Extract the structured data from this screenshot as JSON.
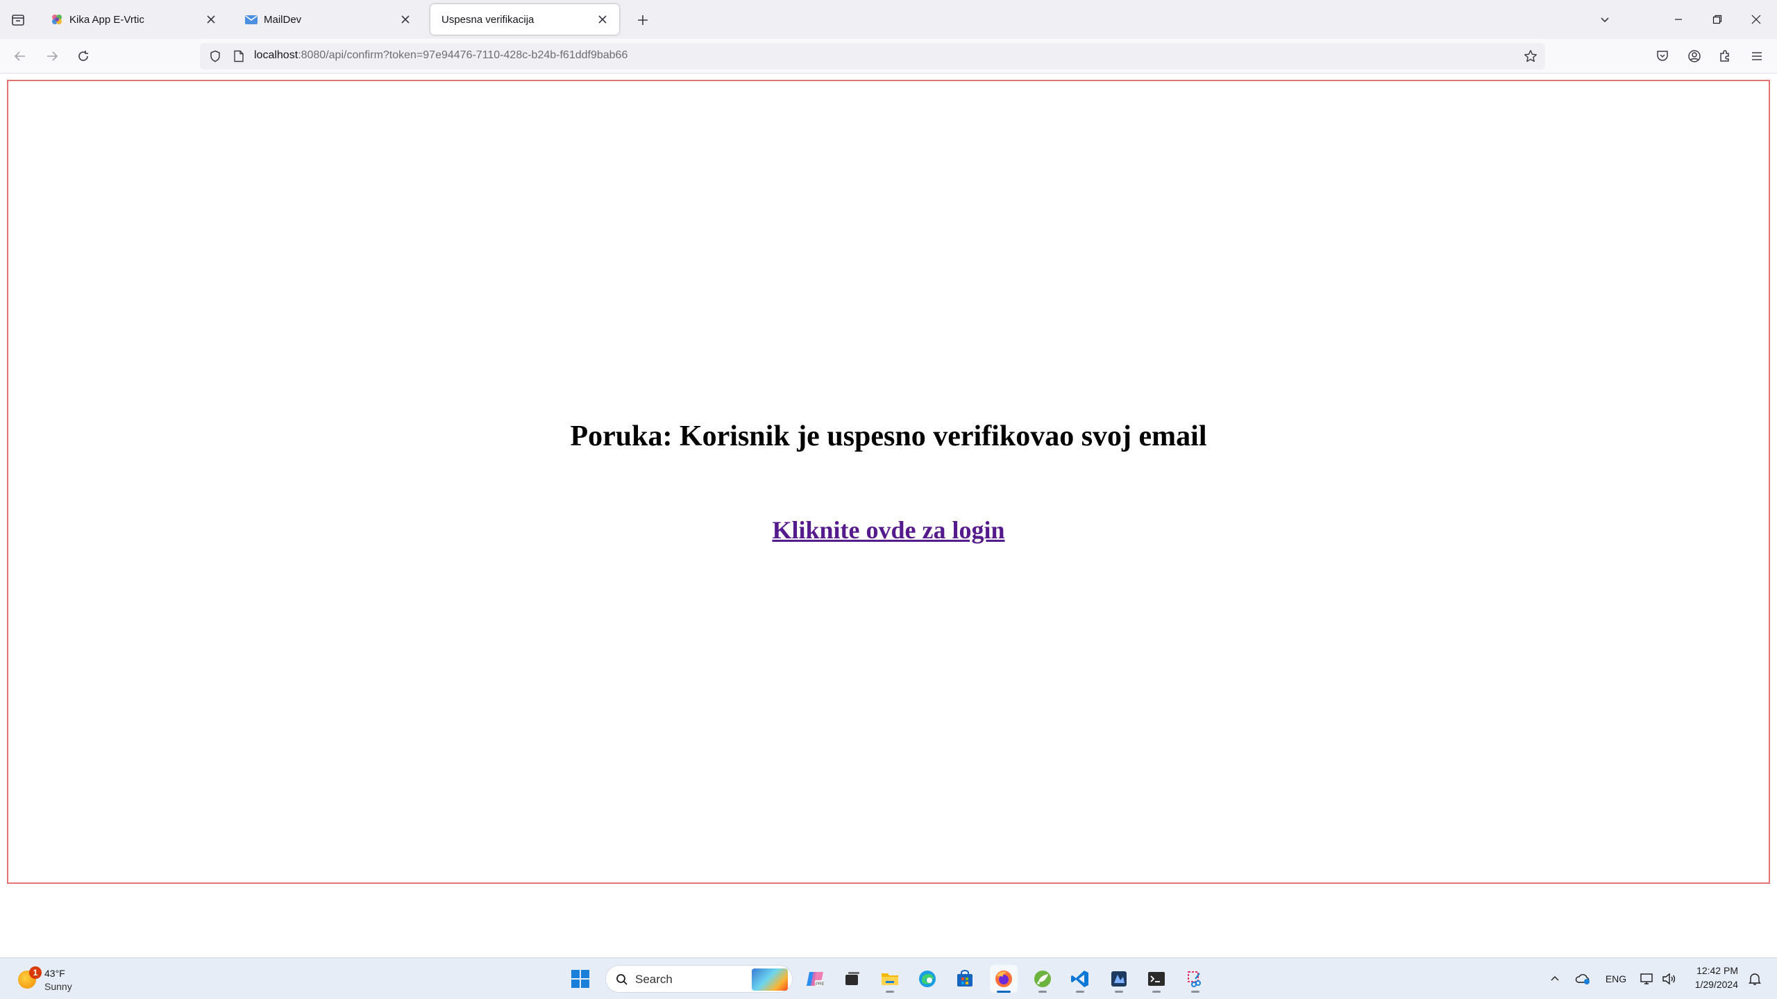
{
  "browser": {
    "tabs": [
      {
        "title": "Kika App E-Vrtic",
        "favicon": "flower-favicon"
      },
      {
        "title": "MailDev",
        "favicon": "mail-favicon"
      },
      {
        "title": "Uspesna verifikacija",
        "favicon": "none",
        "selected": true
      }
    ],
    "url": {
      "host": "localhost",
      "rest": ":8080/api/confirm?token=97e94476-7110-428c-b24b-f61ddf9bab66"
    }
  },
  "page": {
    "message": "Poruka: Korisnik je uspesno verifikovao svoj email",
    "login_link": "Kliknite ovde za login",
    "frame_border_color": "#e57373",
    "link_color": "#551a8b"
  },
  "taskbar": {
    "weather": {
      "temp": "43°F",
      "condition": "Sunny",
      "badge": "1"
    },
    "search_label": "Search",
    "apps": [
      "start-icon",
      "copilot-icon",
      "task-view-icon",
      "file-explorer-icon",
      "edge-icon",
      "store-icon",
      "firefox-icon",
      "spring-icon",
      "vscode-icon",
      "app-icon",
      "terminal-icon",
      "snipping-icon"
    ],
    "tray": {
      "language": "ENG"
    },
    "clock": {
      "time": "12:42 PM",
      "date": "1/29/2024"
    }
  }
}
